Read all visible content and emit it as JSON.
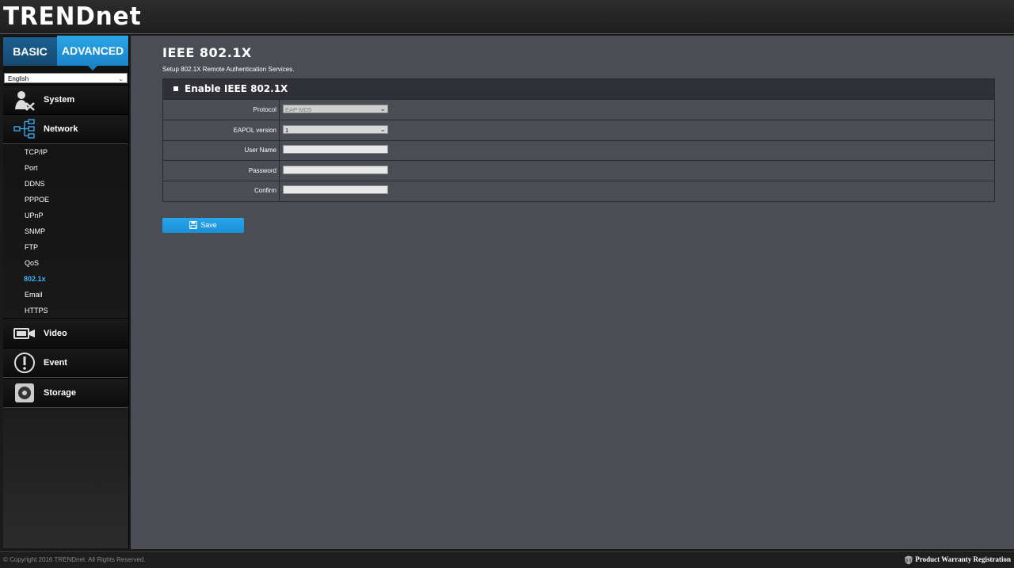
{
  "brand": "TRENDnet",
  "tabs": {
    "basic": "BASIC",
    "advanced": "ADVANCED"
  },
  "language": {
    "selected": "English"
  },
  "menu": {
    "system": "System",
    "network": "Network",
    "video": "Video",
    "event": "Event",
    "storage": "Storage"
  },
  "network_items": [
    "TCP/IP",
    "Port",
    "DDNS",
    "PPPOE",
    "UPnP",
    "SNMP",
    "FTP",
    "QoS",
    "802.1x",
    "Email",
    "HTTPS"
  ],
  "active_item": "802.1x",
  "page": {
    "title": "IEEE 802.1X",
    "subtitle": "Setup 802.1X Remote Authentication Services."
  },
  "form": {
    "enable_label": "Enable IEEE 802.1X",
    "protocol_label": "Protocol",
    "protocol_value": "EAP-MD5",
    "eapol_label": "EAPOL version",
    "eapol_value": "1",
    "username_label": "User Name",
    "username_value": "",
    "password_label": "Password",
    "password_value": "",
    "confirm_label": "Confirm",
    "confirm_value": ""
  },
  "save_label": "Save",
  "footer": {
    "copyright": "© Copyright 2016 TRENDnet. All Rights Reserved.",
    "warranty": "Product Warranty Registration"
  },
  "colors": {
    "accent": "#1a84c7",
    "active_link": "#3fb0f0",
    "content_bg": "#4b4d55"
  }
}
